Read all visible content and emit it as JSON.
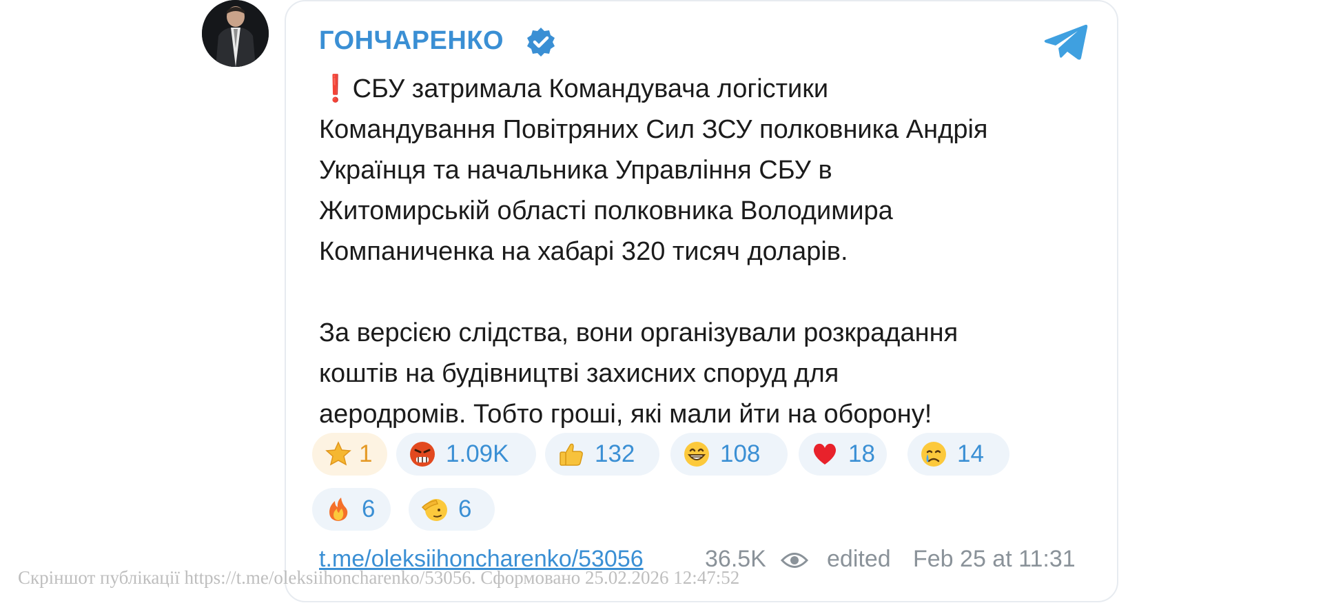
{
  "post": {
    "channel_name": "ГОНЧАРЕНКО",
    "paragraph1": "СБУ затримала Командувача логістики\nКомандування Повітряних Сил ЗСУ полковника Андрія\nУкраїнця та начальника Управління СБУ в\nЖитомирській області полковника Володимира\nКомпаниченка на хабарі 320 тисяч доларів.",
    "paragraph2": "За версією слідства, вони організували розкрадання\nкоштів на будівництві захисних споруд для\nаеродромів. Тобто гроші, які мали йти на оборону!",
    "alert_glyph": "❗"
  },
  "reactions": [
    {
      "icon": "star-icon",
      "count": "1",
      "kind": "paid"
    },
    {
      "icon": "angry-face-icon",
      "count": "1.09K"
    },
    {
      "icon": "thumbs-up-icon",
      "count": "132"
    },
    {
      "icon": "grinning-face-icon",
      "count": "108"
    },
    {
      "icon": "red-heart-icon",
      "count": "18"
    },
    {
      "icon": "crying-face-icon",
      "count": "14"
    },
    {
      "icon": "fire-icon",
      "count": "6"
    },
    {
      "icon": "saluting-face-icon",
      "count": "6"
    }
  ],
  "footer": {
    "link": "t.me/oleksiihoncharenko/53056",
    "views": "36.5K",
    "edited": "edited",
    "date": "Feb 25 at 11:31"
  },
  "watermark": "Скріншот публікації https://t.me/oleksiihoncharenko/53056. Сформовано 25.02.2026 12:47:52",
  "colors": {
    "accent": "#3a8fd4",
    "text": "#1b1b1b",
    "muted": "#8a9299",
    "reaction_bg": "#eef4fa",
    "paid_bg": "#fdf3e2",
    "alert": "#e0242b"
  }
}
